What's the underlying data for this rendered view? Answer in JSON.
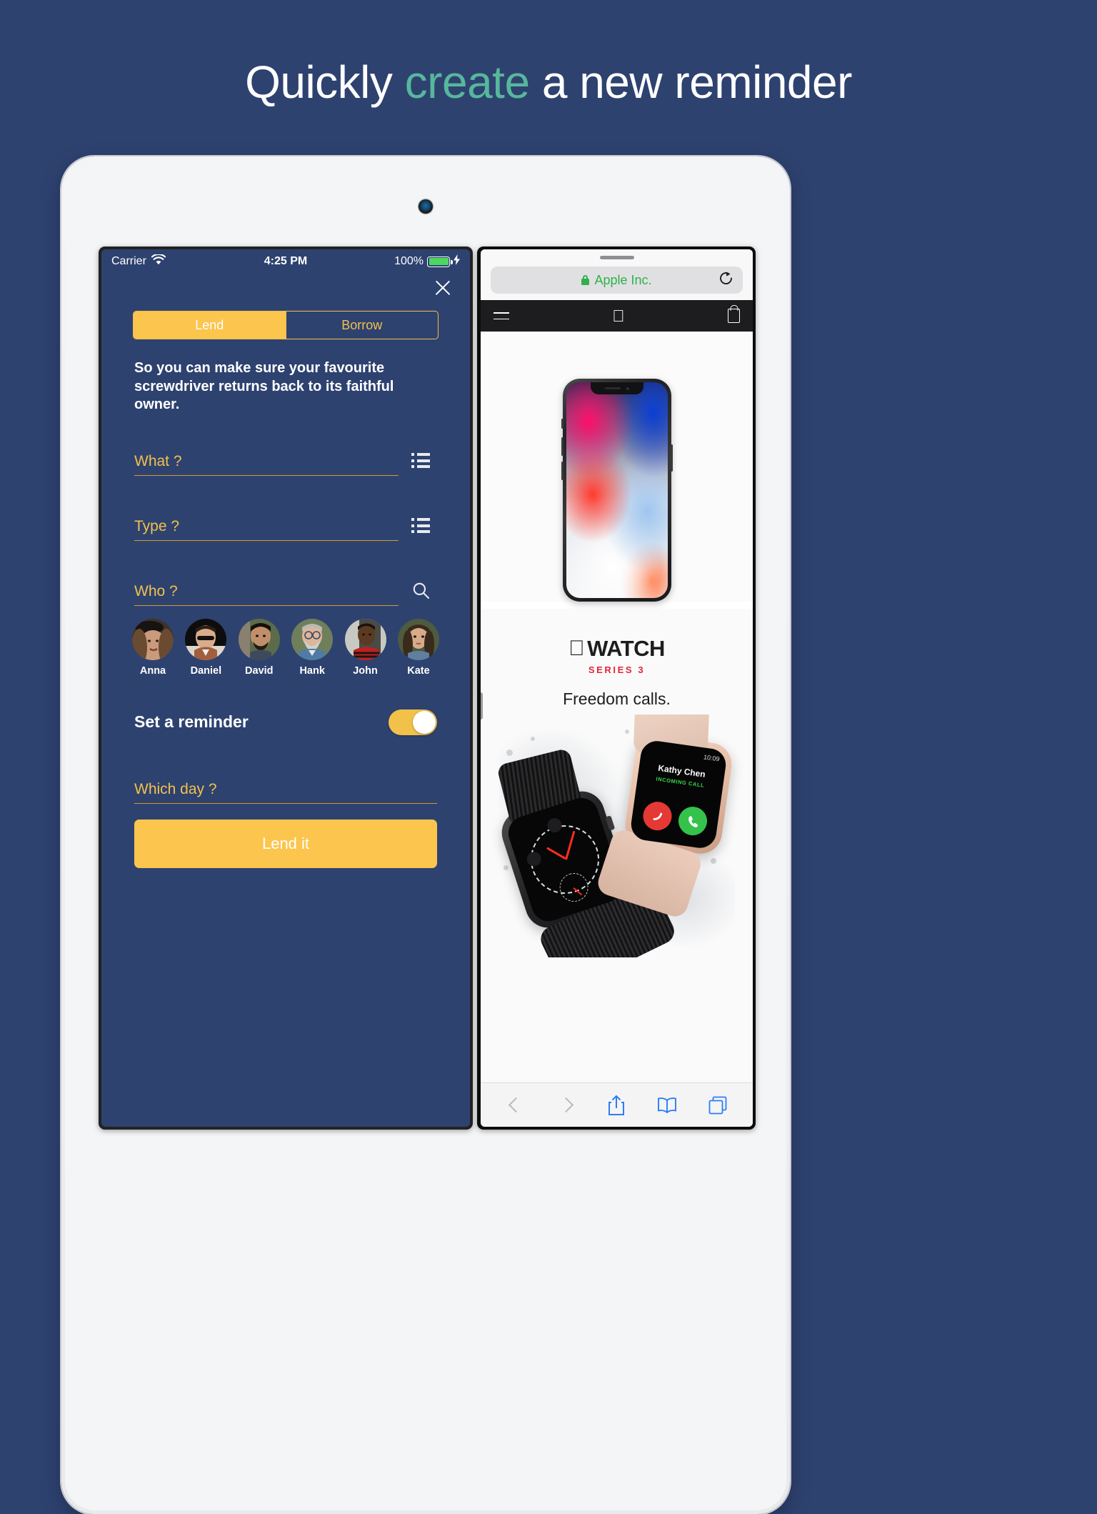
{
  "headline": {
    "part1": "Quickly ",
    "accent": "create",
    "part2": " a new reminder",
    "accent_color": "#57b79c",
    "background_color": "#2e4270"
  },
  "app_screen": {
    "status_bar": {
      "carrier": "Carrier",
      "wifi_icon": "wifi-icon",
      "time": "4:25 PM",
      "battery_percent": "100%",
      "battery_icon": "battery-full-icon",
      "charging_icon": "lightning-bolt-icon"
    },
    "close_button": "close-icon",
    "segmented_control": {
      "options": [
        {
          "label": "Lend",
          "active": true
        },
        {
          "label": "Borrow",
          "active": false
        }
      ]
    },
    "description": "So you can make sure your favourite screwdriver returns back to its faithful owner.",
    "fields": [
      {
        "label": "What ?",
        "value": "",
        "icon": "list-icon"
      },
      {
        "label": "Type ?",
        "value": "",
        "icon": "list-icon"
      },
      {
        "label": "Who ?",
        "value": "",
        "icon": "search-icon"
      }
    ],
    "contacts": [
      {
        "name": "Anna"
      },
      {
        "name": "Daniel"
      },
      {
        "name": "David"
      },
      {
        "name": "Hank"
      },
      {
        "name": "John"
      },
      {
        "name": "Kate"
      }
    ],
    "reminder": {
      "label": "Set a reminder",
      "enabled": true
    },
    "day_field": {
      "label": "Which day ?",
      "value": ""
    },
    "submit_button": "Lend it",
    "colors": {
      "background": "#2e4270",
      "accent": "#fcc54d",
      "field_label": "#f2c14a",
      "field_underline": "#cf9a33"
    }
  },
  "safari_screen": {
    "address_bar": {
      "lock_icon": "lock-icon",
      "url_text": "Apple Inc.",
      "reload_icon": "reload-icon"
    },
    "apple_nav": {
      "menu_icon": "hamburger-menu-icon",
      "logo_icon": "apple-logo-icon",
      "bag_icon": "shopping-bag-icon"
    },
    "hero": {
      "device": "iphone-x-mockup"
    },
    "watch_promo": {
      "logo_glyph": "",
      "wordmark": "WATCH",
      "series": "SERIES 3",
      "tagline": "Freedom calls.",
      "series_color": "#e0263c"
    },
    "watch_photo": {
      "caller_name": "Kathy Chen",
      "call_status": "INCOMING CALL",
      "watch_time": "10:09",
      "decline_icon": "phone-decline-icon",
      "accept_icon": "phone-accept-icon"
    },
    "toolbar": [
      {
        "name": "back",
        "icon": "chevron-left-icon",
        "enabled": false
      },
      {
        "name": "forward",
        "icon": "chevron-right-icon",
        "enabled": false
      },
      {
        "name": "share",
        "icon": "share-icon",
        "enabled": true
      },
      {
        "name": "bookmarks",
        "icon": "book-icon",
        "enabled": true
      },
      {
        "name": "tabs",
        "icon": "tabs-icon",
        "enabled": true
      }
    ]
  }
}
